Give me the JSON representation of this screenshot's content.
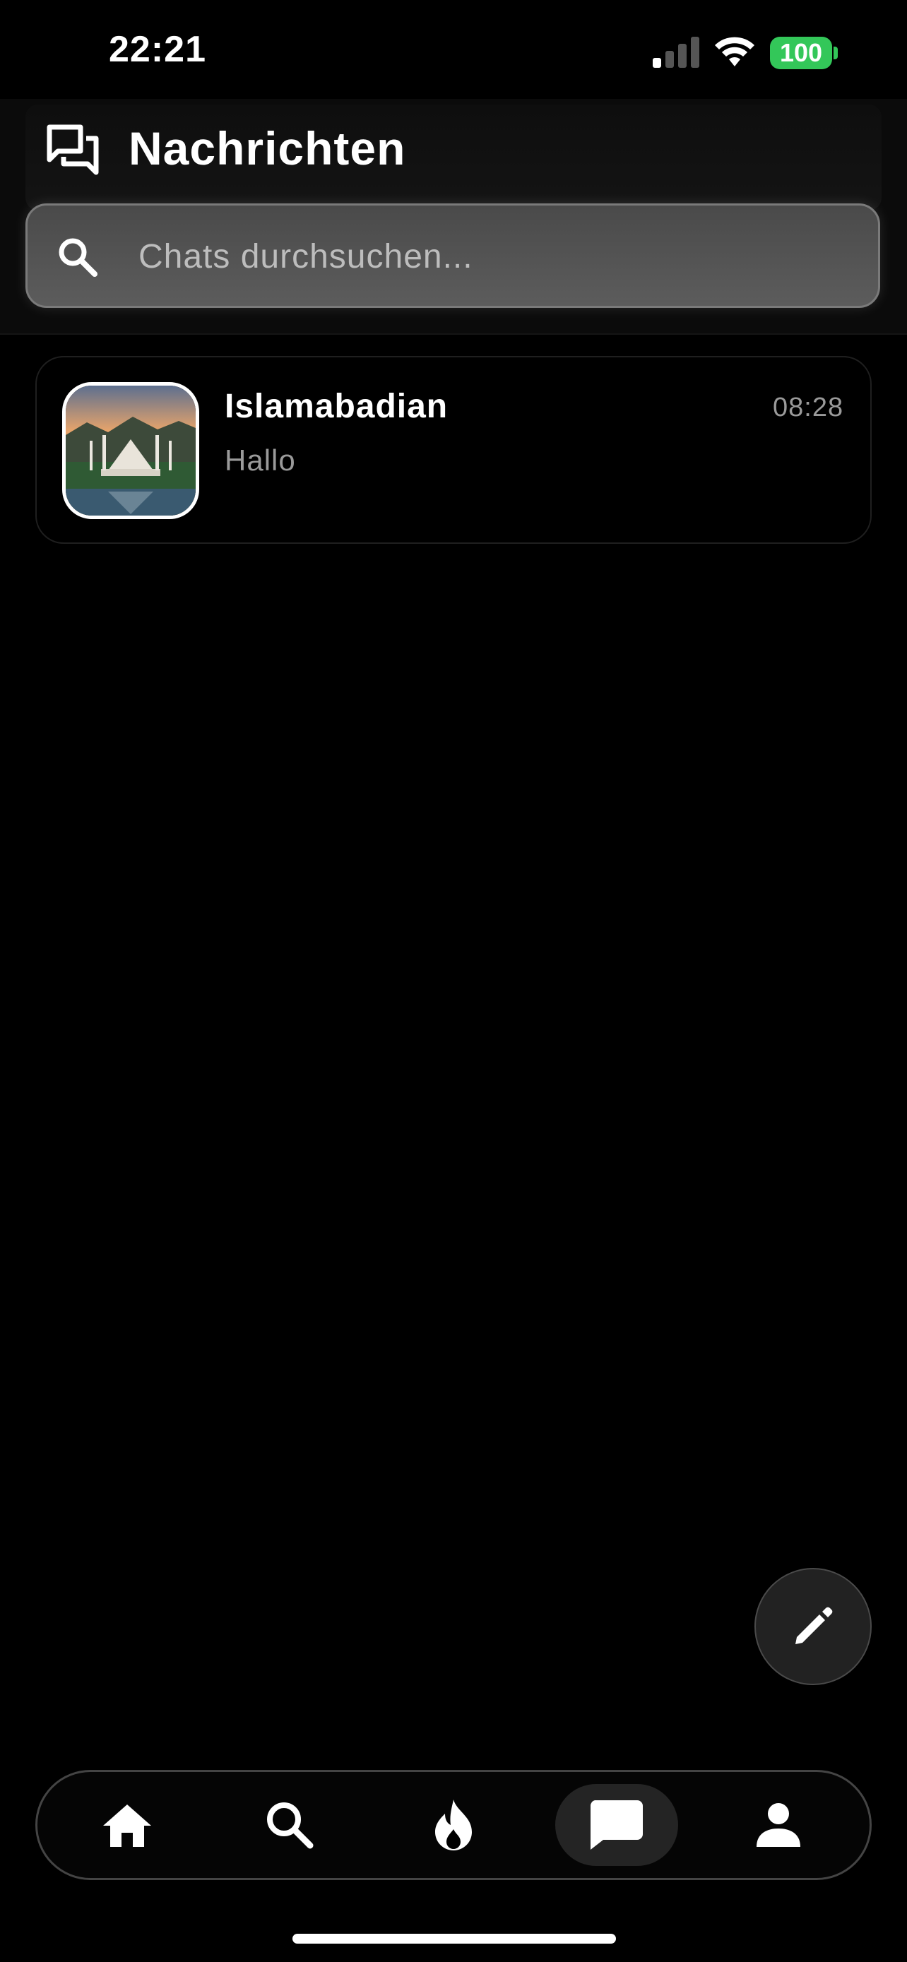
{
  "status_bar": {
    "time": "22:21",
    "battery": "100",
    "signal_icon": "cellular-signal-icon",
    "wifi_icon": "wifi-icon"
  },
  "header": {
    "title": "Nachrichten",
    "icon": "messages-icon"
  },
  "search": {
    "placeholder": "Chats durchsuchen...",
    "value": "",
    "icon": "search-icon"
  },
  "chats": [
    {
      "name": "Islamabadian",
      "time": "08:28",
      "preview": "Hallo",
      "avatar": "mosque-photo-avatar"
    }
  ],
  "fab": {
    "icon": "pencil-icon"
  },
  "bottom_nav": {
    "items": [
      {
        "icon": "home-icon",
        "active": false
      },
      {
        "icon": "search-icon",
        "active": false
      },
      {
        "icon": "flame-icon",
        "active": false
      },
      {
        "icon": "chat-icon",
        "active": true
      },
      {
        "icon": "profile-icon",
        "active": false
      }
    ]
  },
  "colors": {
    "background": "#000000",
    "battery": "#33c759",
    "muted_text": "#9a9a9a"
  }
}
